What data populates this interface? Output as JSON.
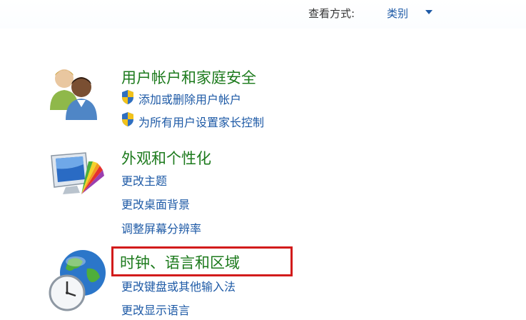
{
  "header": {
    "view_by_label": "查看方式:",
    "view_by_value": "类别"
  },
  "categories": [
    {
      "title": "用户帐户和家庭安全",
      "icon": "users-icon",
      "links": [
        {
          "label": "添加或删除用户帐户",
          "icon": "uac-shield-icon"
        },
        {
          "label": "为所有用户设置家长控制",
          "icon": "uac-shield-icon"
        }
      ]
    },
    {
      "title": "外观和个性化",
      "icon": "appearance-icon",
      "links": [
        {
          "label": "更改主题"
        },
        {
          "label": "更改桌面背景"
        },
        {
          "label": "调整屏幕分辨率"
        }
      ]
    },
    {
      "title": "时钟、语言和区域",
      "icon": "clock-globe-icon",
      "links": [
        {
          "label": "更改键盘或其他输入法"
        },
        {
          "label": "更改显示语言"
        }
      ]
    }
  ],
  "colors": {
    "category_title": "#1c7a1c",
    "link": "#1e5aa6",
    "highlight": "#d21b1b"
  }
}
